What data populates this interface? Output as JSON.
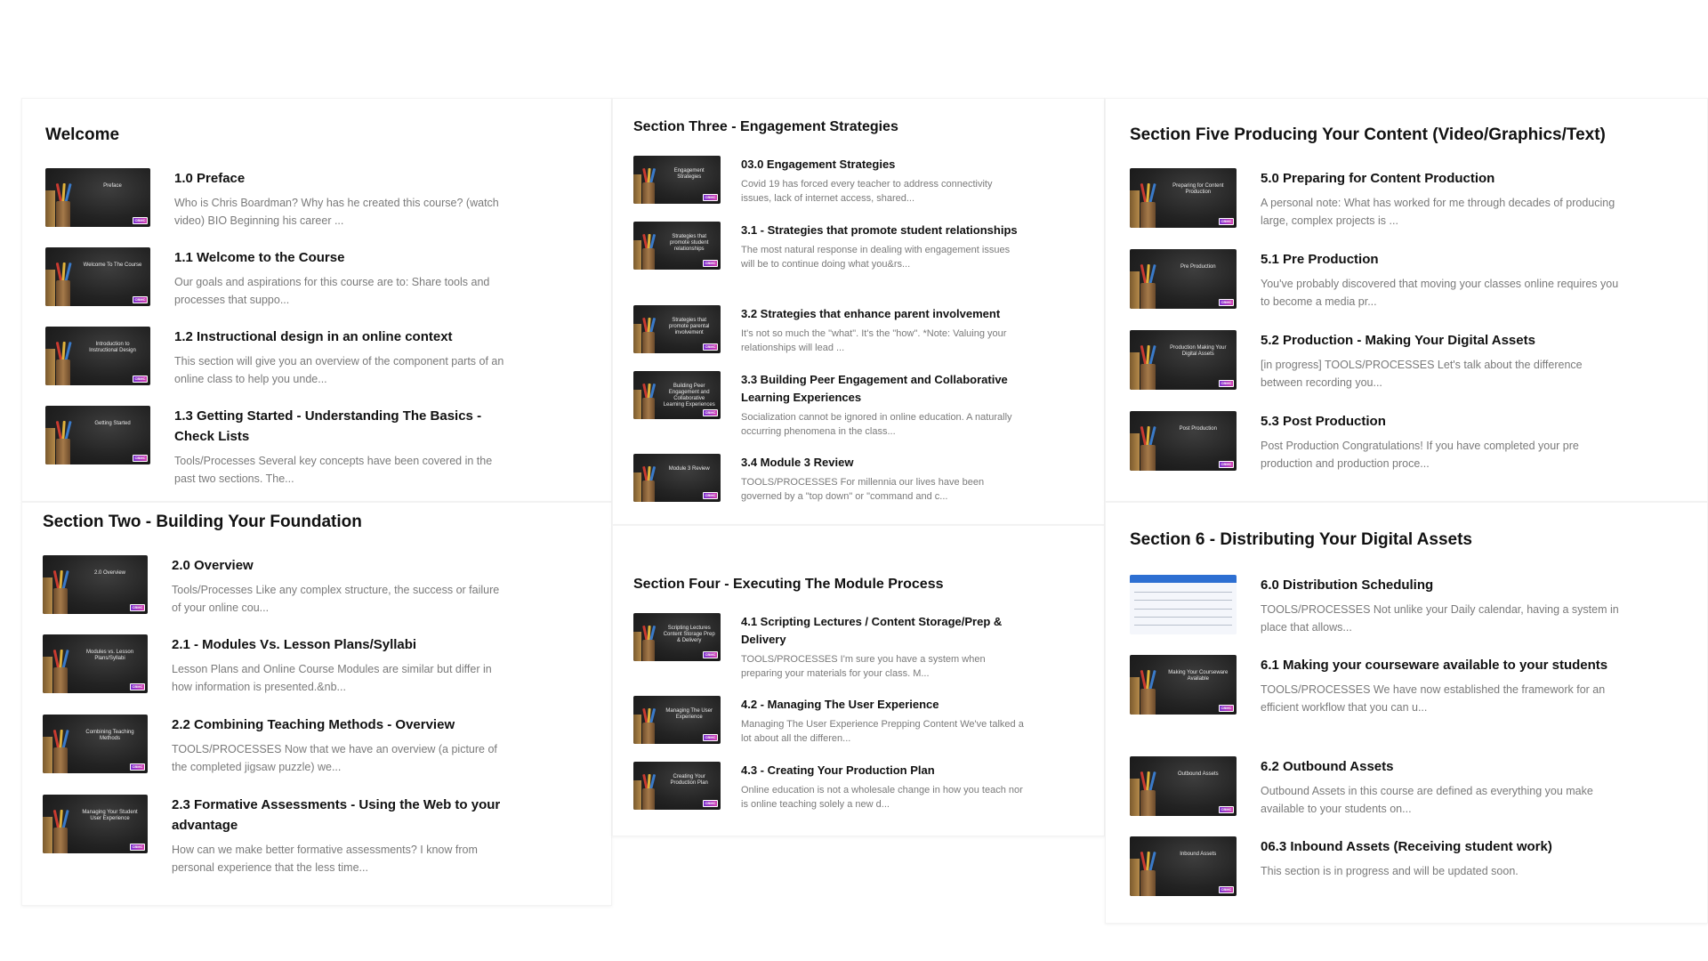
{
  "welcome": {
    "title": "Welcome",
    "lessons": [
      {
        "thumb": "Preface",
        "title": "1.0 Preface",
        "desc": "Who is Chris Boardman? Why has he created this course? (watch video) BIO Beginning his career ..."
      },
      {
        "thumb": "Welcome To The Course",
        "title": "1.1 Welcome to the Course",
        "desc": "  Our goals and aspirations for this course are to: Share tools and processes that suppo..."
      },
      {
        "thumb": "Introduction to Instructional Design",
        "title": "1.2 Instructional design in an online context",
        "desc": "This section will give you an overview of the component parts of an online class to help you unde..."
      },
      {
        "thumb": "Getting Started",
        "title": "1.3 Getting Started - Understanding The Basics - Check Lists",
        "desc": "  Tools/Processes Several key concepts have been covered in the past two sections. The..."
      }
    ]
  },
  "section2": {
    "title": "Section Two - Building Your Foundation",
    "lessons": [
      {
        "thumb": "2.0 Overview",
        "title": "2.0 Overview",
        "desc": "Tools/Processes  Like any complex structure, the success or failure of your online cou..."
      },
      {
        "thumb": "Modules vs. Lesson Plans/Syllabi",
        "title": "2.1 - Modules Vs. Lesson Plans/Syllabi",
        "desc": "Lesson Plans and Online Course Modules are similar but differ in how information is presented.&nb..."
      },
      {
        "thumb": "Combining Teaching Methods",
        "title": "2.2 Combining Teaching Methods - Overview",
        "desc": " TOOLS/PROCESSES Now that we have an overview (a picture of the completed jigsaw puzzle) we..."
      },
      {
        "thumb": "Managing Your Student User Experience",
        "title": "2.3 Formative Assessments - Using the Web to your advantage",
        "desc": "How can we make better formative assessments? I know from personal experience that the less time..."
      }
    ]
  },
  "section3": {
    "title": "Section Three - Engagement Strategies",
    "lessons": [
      {
        "thumb": "Engagement Strategies",
        "title": "03.0 Engagement Strategies",
        "desc": "Covid 19 has forced every teacher to address connectivity issues, lack of internet access, shared..."
      },
      {
        "thumb": "Strategies that promote student relationships",
        "title": "3.1 - Strategies that promote student relationships",
        "desc": "The most natural response in dealing with engagement issues will be to continue doing what you&rs..."
      },
      {
        "thumb": "Strategies that promote parental involvement",
        "title": "3.2 Strategies that enhance parent involvement",
        "desc": "It's not so much the \"what\". It's the \"how\". *Note: Valuing your relationships will lead ..."
      },
      {
        "thumb": "Building Peer Engagement and Collaborative Learning Experiences",
        "title": "3.3 Building Peer Engagement and Collaborative Learning Experiences",
        "desc": "Socialization cannot be ignored in online education. A naturally occurring phenomena in the class..."
      },
      {
        "thumb": "Module 3 Review",
        "title": "3.4 Module 3 Review",
        "desc": "TOOLS/PROCESSES For millennia our lives have been governed by a \"top down\" or \"command and c..."
      }
    ]
  },
  "section4": {
    "title": "Section Four - Executing The Module Process",
    "lessons": [
      {
        "thumb": "Scripting Lectures Content Storage Prep & Delivery",
        "title": "4.1 Scripting Lectures / Content Storage/Prep & Delivery",
        "desc": " TOOLS/PROCESSES I'm sure you have a system when preparing your materials for your class. M..."
      },
      {
        "thumb": "Managing The User Experience",
        "title": "4.2 - Managing The User Experience",
        "desc": "Managing The User Experience Prepping Content We've talked a lot about all the differen..."
      },
      {
        "thumb": "Creating Your Production Plan",
        "title": "4.3 - Creating Your Production Plan",
        "desc": "Online education is not a wholesale change in how you teach nor is online teaching solely a new d..."
      }
    ]
  },
  "section5": {
    "title": "Section Five Producing Your Content (Video/Graphics/Text)",
    "lessons": [
      {
        "thumb": "Preparing for Content Production",
        "title": "5.0 Preparing for Content Production",
        "desc": "A personal note: What has worked for me through decades of producing large, complex projects is ..."
      },
      {
        "thumb": "Pre Production",
        "title": "5.1 Pre Production",
        "desc": "You've probably discovered that moving your classes online requires you to become a media pr..."
      },
      {
        "thumb": "Production Making Your Digital Assets",
        "title": "5.2 Production - Making Your Digital Assets",
        "desc": "[in progress] TOOLS/PROCESSES  Let's talk about the difference between recording you..."
      },
      {
        "thumb": "Post Production",
        "title": "5.3 Post Production",
        "desc": "Post Production Congratulations! If you have completed your pre production and production proce..."
      }
    ]
  },
  "section6": {
    "title": "Section 6 - Distributing Your Digital Assets",
    "lessons": [
      {
        "thumb": "",
        "title": "6.0 Distribution Scheduling",
        "desc": "TOOLS/PROCESSES Not unlike your Daily calendar, having a system in place that allows..."
      },
      {
        "thumb": "Making Your Courseware Available",
        "title": "6.1 Making your courseware available to your students",
        "desc": "TOOLS/PROCESSES We have now established the framework for an efficient workflow that you can u..."
      },
      {
        "thumb": "Outbound Assets",
        "title": "6.2 Outbound Assets",
        "desc": "Outbound Assets in this course are defined as everything you make available to your students on..."
      },
      {
        "thumb": "Inbound Assets",
        "title": "06.3 Inbound Assets (Receiving student work)",
        "desc": "This section is in progress and will be updated soon."
      }
    ]
  },
  "badge_label": "CBMC",
  "colors": {
    "title": "#111111",
    "desc": "#7a7a7a",
    "badge_from": "#7a2fd0",
    "badge_to": "#d23fb0"
  }
}
